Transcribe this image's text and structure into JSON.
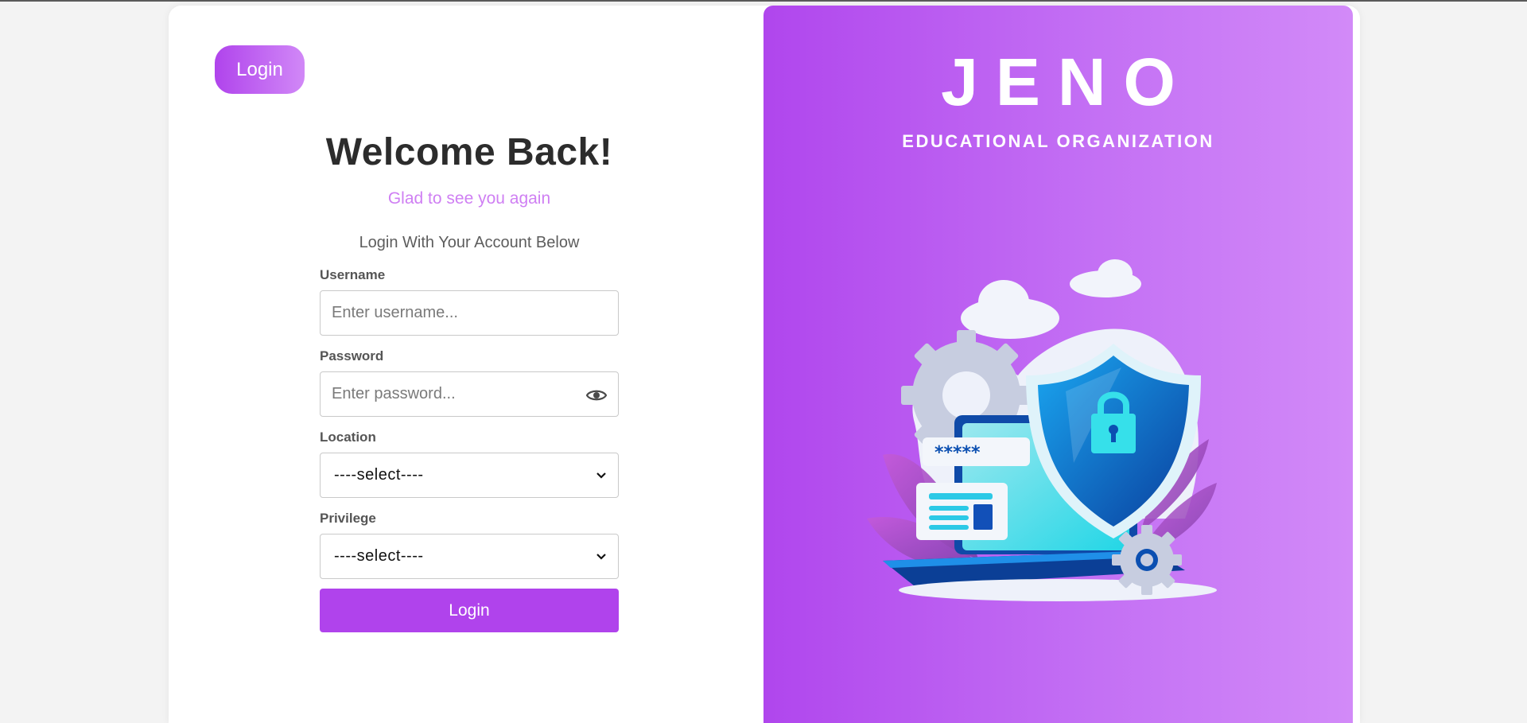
{
  "header": {
    "login_tab_label": "Login"
  },
  "form": {
    "title": "Welcome Back!",
    "subtitle": "Glad to see you again",
    "instruction": "Login With Your Account Below",
    "username": {
      "label": "Username",
      "placeholder": "Enter username...",
      "value": ""
    },
    "password": {
      "label": "Password",
      "placeholder": "Enter password...",
      "value": "",
      "toggle_icon": "eye-icon"
    },
    "location": {
      "label": "Location",
      "selected": "----select----"
    },
    "privilege": {
      "label": "Privilege",
      "selected": "----select----"
    },
    "submit_label": "Login"
  },
  "brand": {
    "name": "JENO",
    "tagline": "EDUCATIONAL ORGANIZATION",
    "illustration": "security-shield-laptop-illustration"
  },
  "colors": {
    "accent": "#b043ec",
    "accent_light": "#d188f7",
    "subtitle": "#cf7ff3",
    "panel_start": "#b046ed",
    "panel_end": "#d28af8"
  }
}
